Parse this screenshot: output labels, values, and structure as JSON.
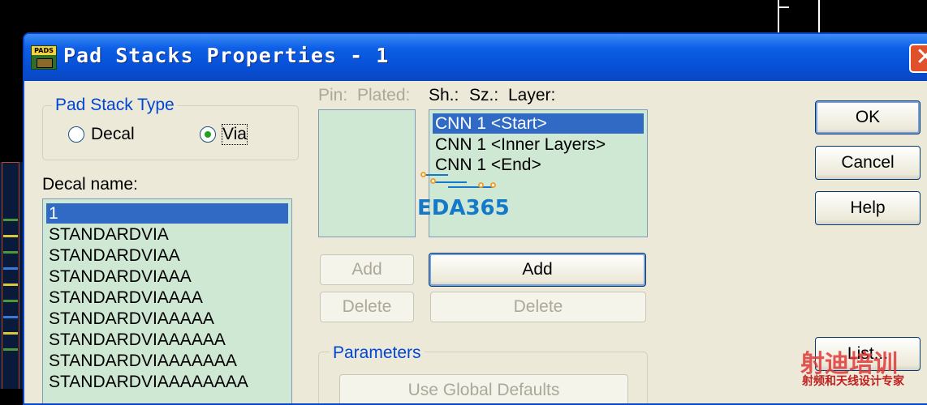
{
  "window": {
    "title": "Pad Stacks Properties - 1",
    "app_icon_tag": "PADS",
    "close_glyph": "✕"
  },
  "pad_stack_type": {
    "legend": "Pad Stack Type",
    "options": [
      {
        "label": "Decal",
        "selected": false
      },
      {
        "label": "Via",
        "selected": true
      }
    ]
  },
  "decal_name": {
    "label": "Decal name:",
    "items": [
      "1",
      "STANDARDVIA",
      "STANDARDVIAA",
      "STANDARDVIAAA",
      "STANDARDVIAAAA",
      "STANDARDVIAAAAA",
      "STANDARDVIAAAAAA",
      "STANDARDVIAAAAAAA",
      "STANDARDVIAAAAAAAA"
    ],
    "selected_index": 0
  },
  "pin_list": {
    "header_pin": "Pin:",
    "header_plated": "Plated:"
  },
  "shape_list": {
    "header_sh": "Sh.:",
    "header_sz": "Sz.:",
    "header_layer": "Layer:",
    "items": [
      "CNN 1 <Start>",
      "CNN 1 <Inner Layers>",
      "CNN 1 <End>"
    ],
    "selected_index": 0
  },
  "pin_buttons": {
    "add": "Add",
    "delete": "Delete"
  },
  "shape_buttons": {
    "add": "Add",
    "delete": "Delete"
  },
  "parameters": {
    "legend": "Parameters",
    "use_global_defaults": "Use Global Defaults"
  },
  "dialog_buttons": {
    "ok": "OK",
    "cancel": "Cancel",
    "help": "Help",
    "list": "List..."
  },
  "watermarks": {
    "eda": "EDA365",
    "cn_big": "射迪培训",
    "cn_small": "射频和天线设计专家"
  },
  "colors": {
    "titlebar": "#0650d6",
    "list_bg": "#cfe8d3",
    "selection": "#316ac5",
    "group_legend": "#0046d5"
  }
}
